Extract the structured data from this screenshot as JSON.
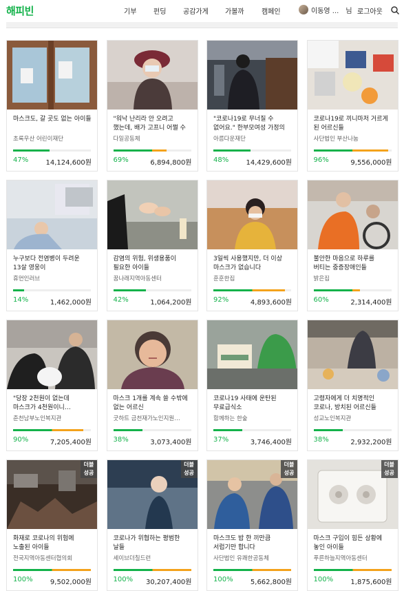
{
  "header": {
    "logo": "해피빈",
    "nav": [
      "기부",
      "펀딩",
      "공감가게",
      "가볼까",
      "캠페인"
    ],
    "user_name": "이동영 ...",
    "user_suffix": "님",
    "logout": "로그아웃"
  },
  "colors": {
    "brand_green": "#13b24a",
    "progress_orange": "#f4a21b",
    "badge_bg": "#4a4a4a"
  },
  "badge": {
    "line1": "더블",
    "line2": "성공"
  },
  "cards": [
    {
      "title": "마스크도, 갈 곳도 없는 아이들",
      "org": "초록우산 어린이재단",
      "percent": "47%",
      "amount": "14,124,600원",
      "progress": 0.47,
      "badge": false,
      "scene": 0
    },
    {
      "title": "\"워낙 난리라 안 오려고 했는데, 배가 고프니 어쩔 수 있…",
      "org": "다일공동체",
      "percent": "69%",
      "amount": "6,894,800원",
      "progress": 0.69,
      "badge": false,
      "scene": 1
    },
    {
      "title": "\"코로나19로 무너질 수 없어요.\" 한부모여성 가정의 위기",
      "org": "아름다운재단",
      "percent": "48%",
      "amount": "14,429,600원",
      "progress": 0.48,
      "badge": false,
      "scene": 2
    },
    {
      "title": "코로나19로 끼니마저 거르게 된 어르신들",
      "org": "사단법인 부산나눔",
      "percent": "96%",
      "amount": "9,556,000원",
      "progress": 0.96,
      "badge": false,
      "scene": 3
    },
    {
      "title": "누구보다 전염병이 두려운 13살 영웅이",
      "org": "휴먼인러브",
      "percent": "14%",
      "amount": "1,462,000원",
      "progress": 0.14,
      "badge": false,
      "scene": 4
    },
    {
      "title": "감염의 위험, 위생용품이 필요한 아이들",
      "org": "꿈나래지역아동센터",
      "percent": "42%",
      "amount": "1,064,200원",
      "progress": 0.42,
      "badge": false,
      "scene": 5
    },
    {
      "title": "3일씩 사용했지만, 더 이상 마스크가 없습니다",
      "org": "훈훈한집",
      "percent": "92%",
      "amount": "4,893,600원",
      "progress": 0.92,
      "badge": false,
      "scene": 6
    },
    {
      "title": "불안한 마음으로 하루를 버티는 중증장애인들",
      "org": "밝은집",
      "percent": "60%",
      "amount": "2,314,400원",
      "progress": 0.6,
      "badge": false,
      "scene": 7
    },
    {
      "title": "\"당장 2천원이 없는데 마스크가 4천원이니…",
      "org": "춘천남부노인복지관",
      "percent": "90%",
      "amount": "7,205,400원",
      "progress": 0.9,
      "badge": false,
      "scene": 8
    },
    {
      "title": "마스크 1개를 계속 쓸 수밖에 없는 어르신",
      "org": "굿하트 금천재가노인지원…",
      "percent": "38%",
      "amount": "3,073,400원",
      "progress": 0.38,
      "badge": false,
      "scene": 9
    },
    {
      "title": "코로나19 사태에 운탄된 무료급식소",
      "org": "함께하는 한숲",
      "percent": "37%",
      "amount": "3,746,400원",
      "progress": 0.37,
      "badge": false,
      "scene": 10
    },
    {
      "title": "고령자에게 더 치명적인 코로나, 방치된 어르신들",
      "org": "성교노인복지관",
      "percent": "38%",
      "amount": "2,932,200원",
      "progress": 0.38,
      "badge": false,
      "scene": 11
    },
    {
      "title": "화재로 코로나의 위험에 노출된 아이들",
      "org": "전국지역아동센터협의회",
      "percent": "100%",
      "amount": "9,502,000원",
      "progress": 1.0,
      "badge": true,
      "scene": 12
    },
    {
      "title": "코로나가 위협하는 평범한 날들",
      "org": "세이브더칠드런",
      "percent": "100%",
      "amount": "30,207,400원",
      "progress": 1.0,
      "badge": true,
      "scene": 13
    },
    {
      "title": "마스크도 밥 한 끼만큼 서럽기만 합니다",
      "org": "사단법인 유쾌한공동체",
      "percent": "100%",
      "amount": "5,662,800원",
      "progress": 1.0,
      "badge": true,
      "scene": 14
    },
    {
      "title": "마스크 구입이 힘든 상황에 놓인 아이들",
      "org": "푸른하늘지역아동센터",
      "percent": "100%",
      "amount": "1,875,600원",
      "progress": 1.0,
      "badge": true,
      "scene": 15
    }
  ]
}
